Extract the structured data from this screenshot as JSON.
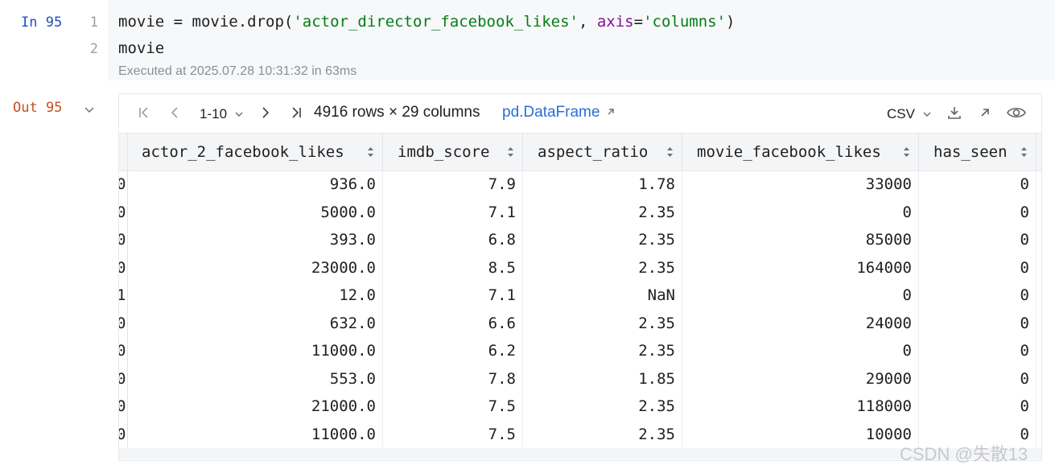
{
  "input_cell": {
    "label": "In 95",
    "lines": [
      {
        "num": "1",
        "parts": [
          {
            "t": "movie = movie.drop(",
            "c": "plain"
          },
          {
            "t": "'actor_director_facebook_likes'",
            "c": "str"
          },
          {
            "t": ", ",
            "c": "plain"
          },
          {
            "t": "axis",
            "c": "kw"
          },
          {
            "t": "=",
            "c": "plain"
          },
          {
            "t": "'columns'",
            "c": "str"
          },
          {
            "t": ")",
            "c": "plain"
          }
        ]
      },
      {
        "num": "2",
        "parts": [
          {
            "t": "movie",
            "c": "plain"
          }
        ]
      }
    ],
    "executed": "Executed at 2025.07.28 10:31:32 in 63ms"
  },
  "output_cell": {
    "label": "Out 95",
    "toolbar": {
      "range": "1-10",
      "summary": "4916 rows × 29 columns",
      "type_link": "pd.DataFrame",
      "export_format": "CSV"
    },
    "columns": [
      "actor_2_facebook_likes",
      "imdb_score",
      "aspect_ratio",
      "movie_facebook_likes",
      "has_seen"
    ],
    "partial_col": [
      "0",
      "0",
      "0",
      "0",
      "1",
      "0",
      "0",
      "0",
      "0",
      "0"
    ],
    "rows": [
      [
        "936.0",
        "7.9",
        "1.78",
        "33000",
        "0"
      ],
      [
        "5000.0",
        "7.1",
        "2.35",
        "0",
        "0"
      ],
      [
        "393.0",
        "6.8",
        "2.35",
        "85000",
        "0"
      ],
      [
        "23000.0",
        "8.5",
        "2.35",
        "164000",
        "0"
      ],
      [
        "12.0",
        "7.1",
        "NaN",
        "0",
        "0"
      ],
      [
        "632.0",
        "6.6",
        "2.35",
        "24000",
        "0"
      ],
      [
        "11000.0",
        "6.2",
        "2.35",
        "0",
        "0"
      ],
      [
        "553.0",
        "7.8",
        "1.85",
        "29000",
        "0"
      ],
      [
        "21000.0",
        "7.5",
        "2.35",
        "118000",
        "0"
      ],
      [
        "11000.0",
        "7.5",
        "2.35",
        "10000",
        "0"
      ]
    ]
  },
  "watermark": "CSDN @失散13",
  "icons": {
    "first_page": "first-page-icon",
    "prev_page": "prev-page-icon",
    "next_page": "next-page-icon",
    "last_page": "last-page-icon",
    "download": "download-icon",
    "open": "open-in-new-icon",
    "view": "eye-icon"
  }
}
